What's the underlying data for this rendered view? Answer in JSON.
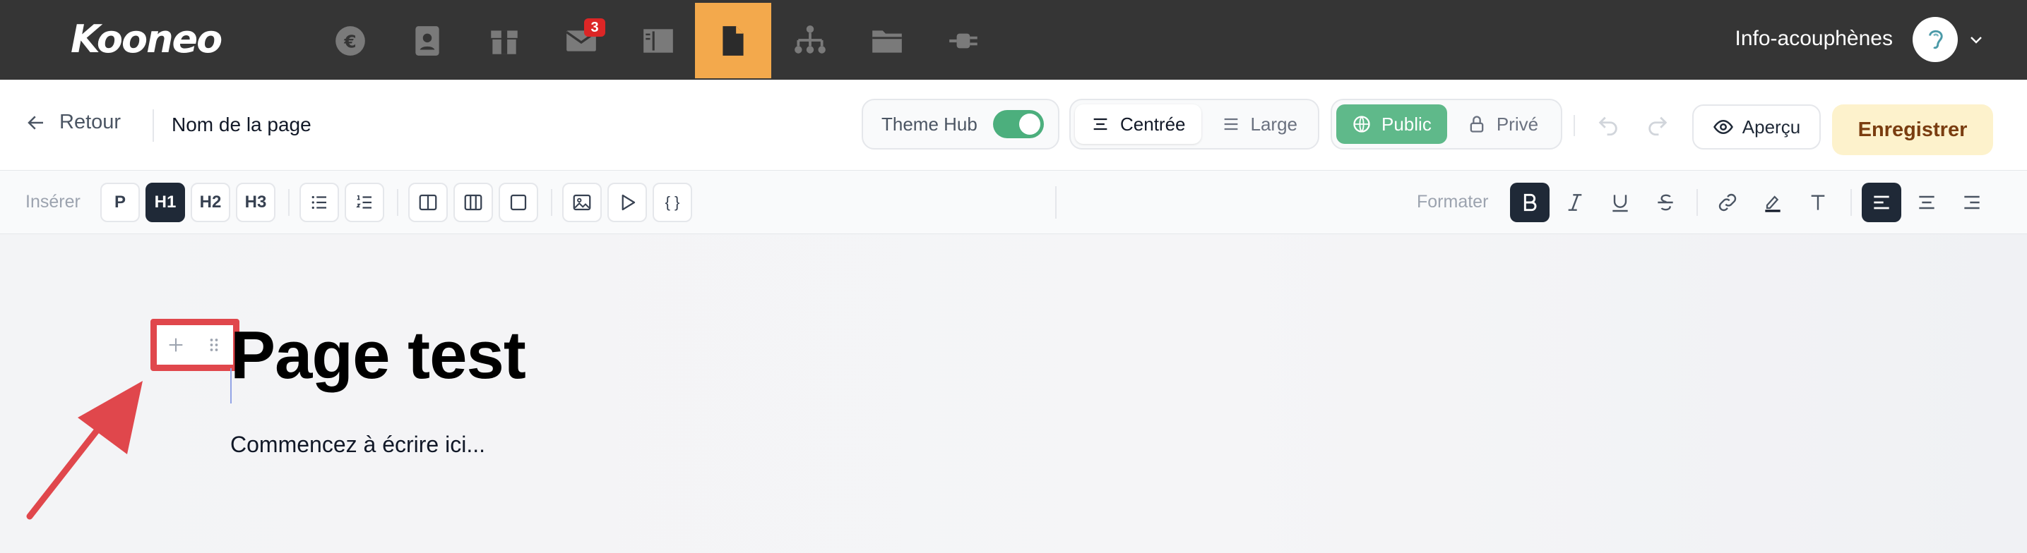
{
  "topbar": {
    "logo": "Kooneo",
    "nav_icons": [
      {
        "name": "euro-icon",
        "badge": null,
        "active": false
      },
      {
        "name": "contacts-icon",
        "badge": null,
        "active": false
      },
      {
        "name": "box-icon",
        "badge": null,
        "active": false
      },
      {
        "name": "mail-icon",
        "badge": "3",
        "active": false
      },
      {
        "name": "layout-icon",
        "badge": null,
        "active": false
      },
      {
        "name": "page-icon",
        "badge": null,
        "active": true
      },
      {
        "name": "sitemap-icon",
        "badge": null,
        "active": false
      },
      {
        "name": "folder-icon",
        "badge": null,
        "active": false
      },
      {
        "name": "plug-icon",
        "badge": null,
        "active": false
      }
    ],
    "account_name": "Info-acouphènes"
  },
  "toolbar": {
    "back_label": "Retour",
    "page_name": "Nom de la page",
    "theme_label": "Theme Hub",
    "theme_enabled": true,
    "width_options": [
      "Centrée",
      "Large"
    ],
    "width_selected": "Centrée",
    "visibility_options": [
      "Public",
      "Privé"
    ],
    "visibility_selected": "Public",
    "preview_label": "Aperçu",
    "save_label": "Enregistrer"
  },
  "formatbar": {
    "insert_label": "Insérer",
    "block_types": [
      "P",
      "H1",
      "H2",
      "H3"
    ],
    "block_selected": "H1",
    "format_label": "Formater",
    "code_label": "{ }"
  },
  "editor": {
    "title": "Page test",
    "placeholder": "Commencez à écrire ici..."
  },
  "colors": {
    "topbar_bg": "#353535",
    "active_nav": "#f3a94c",
    "public_green": "#5fb98a",
    "save_bg": "#fdf2cc",
    "highlight_red": "#e0474c"
  }
}
